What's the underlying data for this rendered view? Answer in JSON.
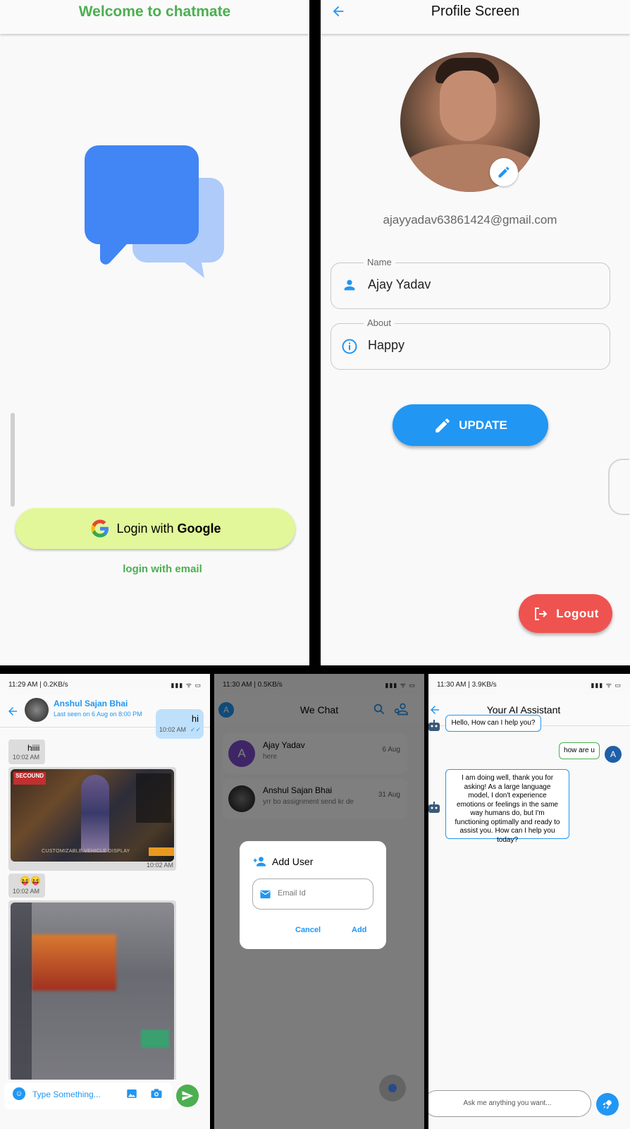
{
  "login": {
    "title": "Welcome to chatmate",
    "google_btn_prefix": "Login with ",
    "google_btn_bold": "Google",
    "email_link": "login with email",
    "brand_color": "#4caf50",
    "button_color": "#e1f79a"
  },
  "profile": {
    "title": "Profile Screen",
    "email": "ajayyadav63861424@gmail.com",
    "name_label": "Name",
    "name_value": "Ajay Yadav",
    "about_label": "About",
    "about_value": "Happy",
    "update_label": "UPDATE",
    "logout_label": "Logout",
    "accent": "#2196f3",
    "logout_color": "#ef5350"
  },
  "chat": {
    "status_left": "11:29 AM | 0.2KB/s",
    "contact_name": "Anshul Sajan Bhai",
    "last_seen": "Last seen on 6 Aug on 8:00 PM",
    "messages": [
      {
        "text": "hi",
        "time": "10:02 AM"
      },
      {
        "text": "hiiii",
        "time": "10:02 AM"
      },
      {
        "text": "",
        "time": "10:02 AM"
      },
      {
        "text": "😝😝",
        "time": "10:02 AM"
      }
    ],
    "game_banner": "CUSTOMIZABLE VEHICLE DISPLAY",
    "input_placeholder": "Type Something..."
  },
  "home": {
    "status_left": "11:30 AM | 0.5KB/s",
    "title": "We Chat",
    "avatar_letter": "A",
    "chats": [
      {
        "name": "Ajay Yadav",
        "preview": "here",
        "date": "6 Aug",
        "initial": "A"
      },
      {
        "name": "Anshul Sajan Bhai",
        "preview": "yrr bo assignment send kr de",
        "date": "31 Aug",
        "initial": ""
      }
    ],
    "dialog": {
      "title": "Add User",
      "placeholder": "Email Id",
      "cancel": "Cancel",
      "add": "Add"
    }
  },
  "ai": {
    "status_left": "11:30 AM | 3.9KB/s",
    "title": "Your AI Assistant",
    "messages": [
      {
        "from": "bot",
        "text": "Hello, How can I help you?"
      },
      {
        "from": "user",
        "text": "how are u"
      },
      {
        "from": "bot",
        "text": "I am doing well, thank you for asking!  As a large language model, I don't experience emotions or feelings in the same way humans do, but I'm functioning optimally and ready to assist you. How can I help you today?"
      }
    ],
    "user_initial": "A",
    "input_placeholder": "Ask me anything you want..."
  }
}
